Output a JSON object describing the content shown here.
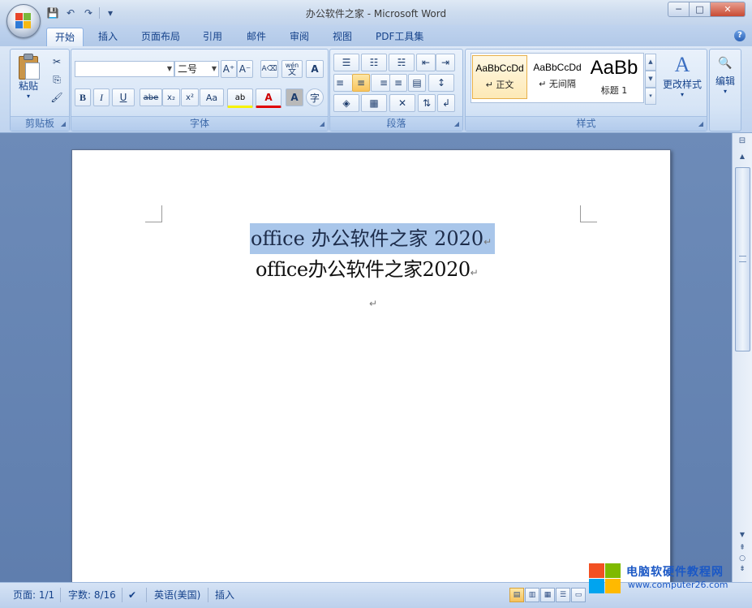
{
  "window": {
    "title": "办公软件之家 - Microsoft Word",
    "controls": {
      "minimize": "─",
      "restore": "□",
      "close": "✕"
    }
  },
  "quick_access": {
    "save": "💾",
    "undo": "↶",
    "redo": "↷",
    "customize": "▾"
  },
  "tabs": [
    {
      "label": "开始",
      "active": true
    },
    {
      "label": "插入",
      "active": false
    },
    {
      "label": "页面布局",
      "active": false
    },
    {
      "label": "引用",
      "active": false
    },
    {
      "label": "邮件",
      "active": false
    },
    {
      "label": "审阅",
      "active": false
    },
    {
      "label": "视图",
      "active": false
    },
    {
      "label": "PDF工具集",
      "active": false
    }
  ],
  "help": "?",
  "ribbon": {
    "clipboard": {
      "label": "剪贴板",
      "paste": "粘贴",
      "cut": "✂",
      "copy": "⎘",
      "format_painter": "🖌"
    },
    "font": {
      "label": "字体",
      "font_name": "",
      "font_size": "二号",
      "grow": "A⁺",
      "shrink": "A⁻",
      "clear": "A⌫",
      "phonetic": "wén",
      "phonetic_char": "文",
      "border_char": "A",
      "bold": "B",
      "italic": "I",
      "underline": "U",
      "strike": "abe",
      "subscript": "x₂",
      "superscript": "x²",
      "case": "Aa",
      "highlight": "ab",
      "color": "A",
      "shade": "A",
      "enclose": "字"
    },
    "paragraph": {
      "label": "段落",
      "bullets": "☰",
      "numbering": "☷",
      "multilevel": "☵",
      "dec_indent": "⇤",
      "inc_indent": "⇥",
      "align_left": "≡",
      "center": "≡",
      "align_right": "≡",
      "justify": "≡",
      "distribute": "▤",
      "line_spacing": "↕",
      "shading": "◈",
      "borders": "▦",
      "asian": "✕",
      "sort": "⇅",
      "marks": "↲"
    },
    "styles": {
      "label": "样式",
      "items": [
        {
          "sample": "AaBbCcDd",
          "name": "↵ 正文",
          "selected": true
        },
        {
          "sample": "AaBbCcDd",
          "name": "↵ 无间隔",
          "selected": false
        },
        {
          "sample": "AaBb",
          "name": "标题 1",
          "selected": false
        }
      ],
      "change_styles": "更改样式"
    },
    "editing": {
      "label": "编辑",
      "icon": "🔍"
    }
  },
  "document": {
    "line1": "office 办公软件之家 2020",
    "line2": "office办公软件之家2020",
    "para_mark": "↵"
  },
  "status": {
    "page": "页面: 1/1",
    "words": "字数: 8/16",
    "language": "英语(美国)",
    "mode": "插入"
  },
  "watermark": {
    "line1": "电脑软硬件教程网",
    "line2": "www.computer26.com"
  },
  "colors": {
    "accent": "#15428b",
    "selection": "#a9c6ea"
  }
}
